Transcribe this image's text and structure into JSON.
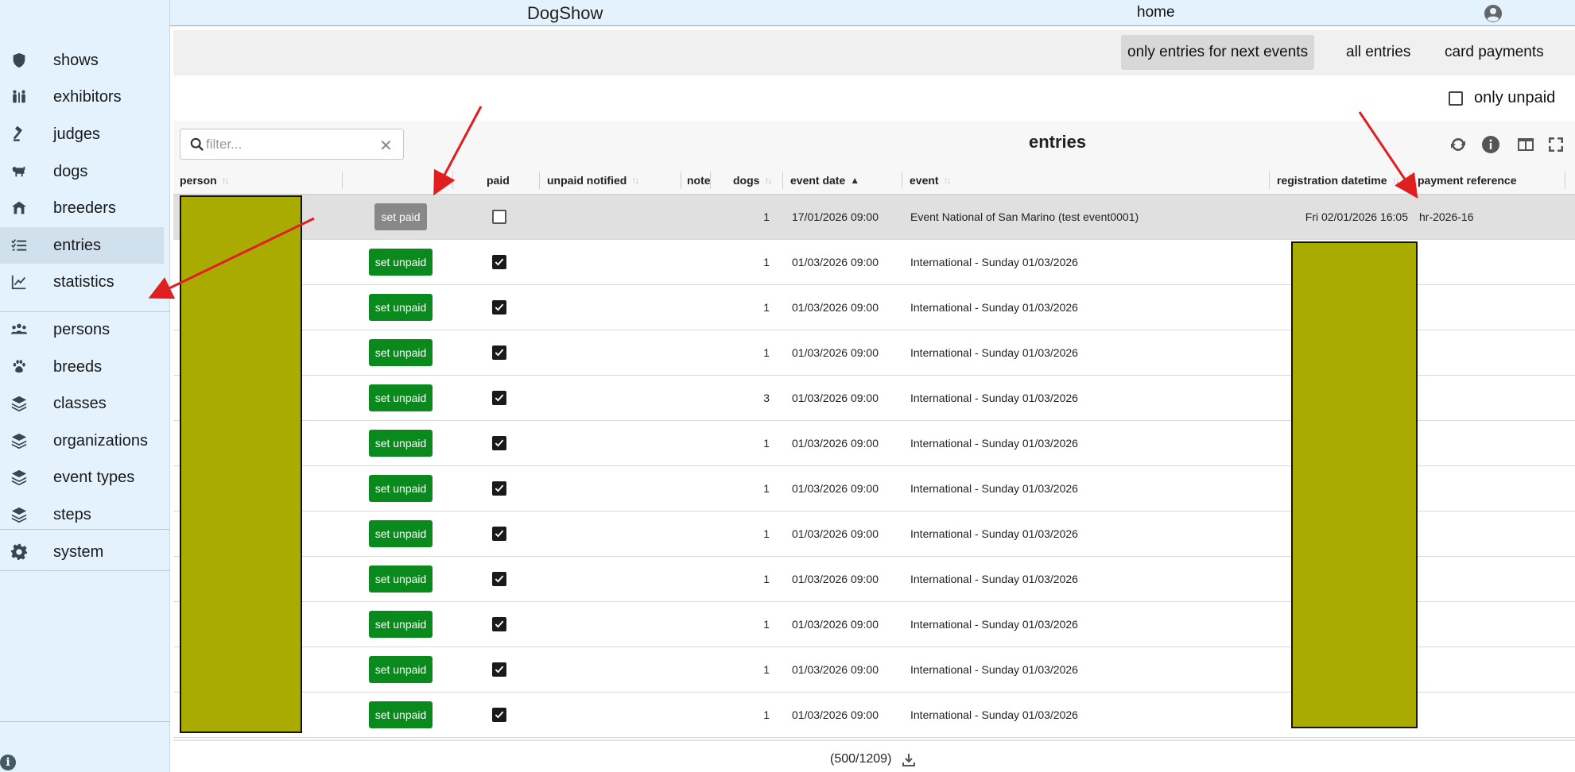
{
  "app": {
    "title": "DogShow",
    "home_label": "home"
  },
  "sidebar": {
    "groups": [
      [
        {
          "label": "shows",
          "icon": "shield-icon"
        },
        {
          "label": "exhibitors",
          "icon": "people-icon"
        },
        {
          "label": "judges",
          "icon": "gavel-icon"
        },
        {
          "label": "dogs",
          "icon": "dog-icon"
        },
        {
          "label": "breeders",
          "icon": "breeders-icon"
        },
        {
          "label": "entries",
          "icon": "list-check-icon",
          "active": true
        },
        {
          "label": "statistics",
          "icon": "chart-line-icon"
        }
      ],
      [
        {
          "label": "persons",
          "icon": "persons-icon"
        },
        {
          "label": "breeds",
          "icon": "paw-icon"
        },
        {
          "label": "classes",
          "icon": "layers-icon"
        },
        {
          "label": "organizations",
          "icon": "layers-icon"
        },
        {
          "label": "event types",
          "icon": "layers-icon"
        },
        {
          "label": "steps",
          "icon": "layers-icon"
        }
      ],
      [
        {
          "label": "system",
          "icon": "gear-icon"
        }
      ]
    ]
  },
  "subnav": {
    "tabs": [
      {
        "label": "only entries for next events",
        "active": true
      },
      {
        "label": "all entries"
      },
      {
        "label": "card payments"
      }
    ]
  },
  "filters": {
    "only_unpaid_label": "only unpaid",
    "only_unpaid": false
  },
  "table": {
    "title": "entries",
    "search_placeholder": "filter...",
    "columns": {
      "person": "person",
      "paid": "paid",
      "unpaid_notified": "unpaid notified",
      "note": "note",
      "dogs": "dogs",
      "event_date": "event date",
      "event": "event",
      "registration_datetime": "registration datetime",
      "payment_reference": "payment reference"
    },
    "rows": [
      {
        "action": "set paid",
        "paid": false,
        "dogs": "1",
        "event_date": "17/01/2026 09:00",
        "event": "Event National of San Marino (test event0001)",
        "registration": "Fri 02/01/2026 16:05",
        "payment_reference": "hr-2026-16"
      },
      {
        "action": "set unpaid",
        "paid": true,
        "dogs": "1",
        "event_date": "01/03/2026 09:00",
        "event": "International - Sunday 01/03/2026",
        "registration": "",
        "payment_reference": ""
      },
      {
        "action": "set unpaid",
        "paid": true,
        "dogs": "1",
        "event_date": "01/03/2026 09:00",
        "event": "International - Sunday 01/03/2026",
        "registration": "",
        "payment_reference": ""
      },
      {
        "action": "set unpaid",
        "paid": true,
        "dogs": "1",
        "event_date": "01/03/2026 09:00",
        "event": "International - Sunday 01/03/2026",
        "registration": "",
        "payment_reference": ""
      },
      {
        "action": "set unpaid",
        "paid": true,
        "dogs": "3",
        "event_date": "01/03/2026 09:00",
        "event": "International - Sunday 01/03/2026",
        "registration": "",
        "payment_reference": ""
      },
      {
        "action": "set unpaid",
        "paid": true,
        "dogs": "1",
        "event_date": "01/03/2026 09:00",
        "event": "International - Sunday 01/03/2026",
        "registration": "",
        "payment_reference": ""
      },
      {
        "action": "set unpaid",
        "paid": true,
        "dogs": "1",
        "event_date": "01/03/2026 09:00",
        "event": "International - Sunday 01/03/2026",
        "registration": "",
        "payment_reference": ""
      },
      {
        "action": "set unpaid",
        "paid": true,
        "dogs": "1",
        "event_date": "01/03/2026 09:00",
        "event": "International - Sunday 01/03/2026",
        "registration": "",
        "payment_reference": ""
      },
      {
        "action": "set unpaid",
        "paid": true,
        "dogs": "1",
        "event_date": "01/03/2026 09:00",
        "event": "International - Sunday 01/03/2026",
        "registration": "",
        "payment_reference": ""
      },
      {
        "action": "set unpaid",
        "paid": true,
        "dogs": "1",
        "event_date": "01/03/2026 09:00",
        "event": "International - Sunday 01/03/2026",
        "registration": "",
        "payment_reference": ""
      },
      {
        "action": "set unpaid",
        "paid": true,
        "dogs": "1",
        "event_date": "01/03/2026 09:00",
        "event": "International - Sunday 01/03/2026",
        "registration": "",
        "payment_reference": ""
      },
      {
        "action": "set unpaid",
        "paid": true,
        "dogs": "1",
        "event_date": "01/03/2026 09:00",
        "event": "International - Sunday 01/03/2026",
        "registration": "",
        "payment_reference": ""
      }
    ],
    "count_text": "(500/1209)"
  },
  "colors": {
    "set_unpaid": "#0a8a1c",
    "set_paid": "#888888",
    "redaction": "#a9ab00",
    "annotation_arrow": "#e02020"
  }
}
